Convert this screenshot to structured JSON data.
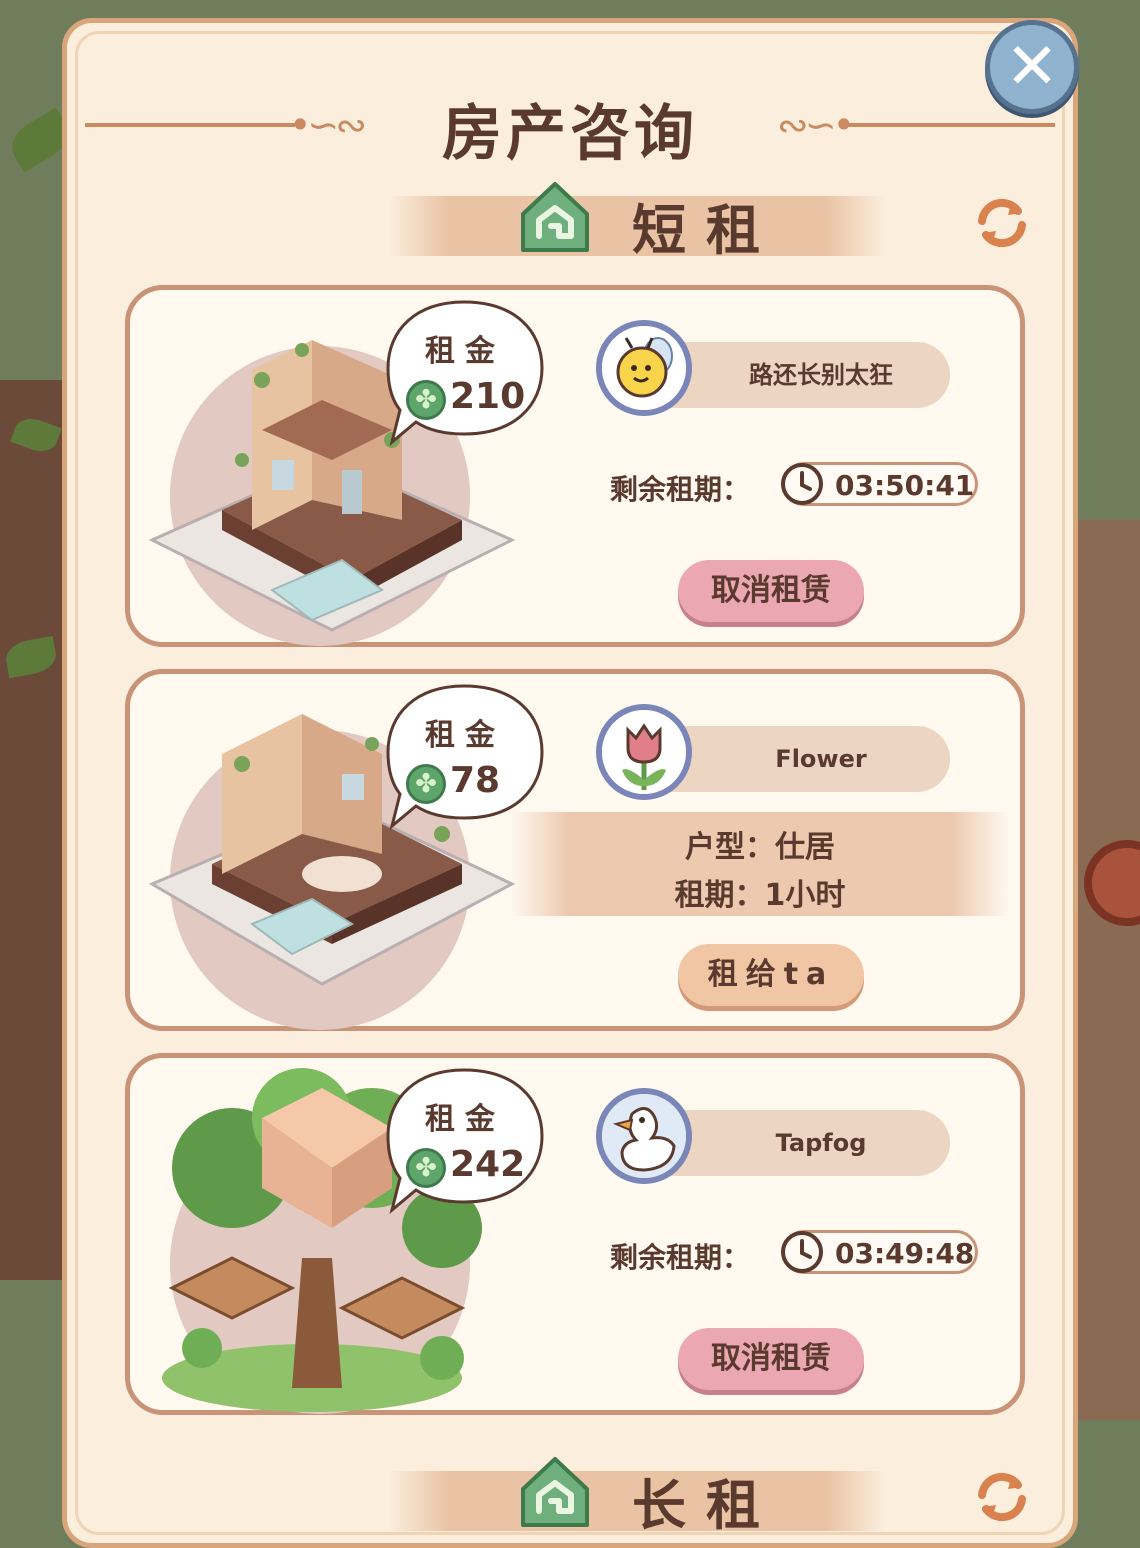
{
  "panel": {
    "title": "房产咨询",
    "close_icon": "close-icon"
  },
  "sections": {
    "short": {
      "title": "短租",
      "icon": "house-icon",
      "refresh_icon": "refresh-icon"
    },
    "long": {
      "title": "长租",
      "icon": "house-icon",
      "refresh_icon": "refresh-icon"
    }
  },
  "listings": [
    {
      "rent_label": "租金",
      "rent_value": "210",
      "tenant_name": "路还长别太狂",
      "avatar": "bee-avatar",
      "remaining_label": "剩余租期：",
      "timer": "03:50:41",
      "action_label": "取消租赁"
    },
    {
      "rent_label": "租金",
      "rent_value": "78",
      "tenant_name": "Flower",
      "avatar": "tulip-avatar",
      "room_type": "户型：仕居",
      "term": "租期：1小时",
      "action_label": "租给ta"
    },
    {
      "rent_label": "租金",
      "rent_value": "242",
      "tenant_name": "Tapfog",
      "avatar": "duck-avatar",
      "remaining_label": "剩余租期：",
      "timer": "03:49:48",
      "action_label": "取消租赁"
    }
  ],
  "colors": {
    "panel_bg": "#fbeedd",
    "panel_border": "#d9a57b",
    "text": "#5a3a2e",
    "cancel_btn": "#eba7b2",
    "rent_btn": "#f1c6a5",
    "coin": "#5ea56a"
  }
}
